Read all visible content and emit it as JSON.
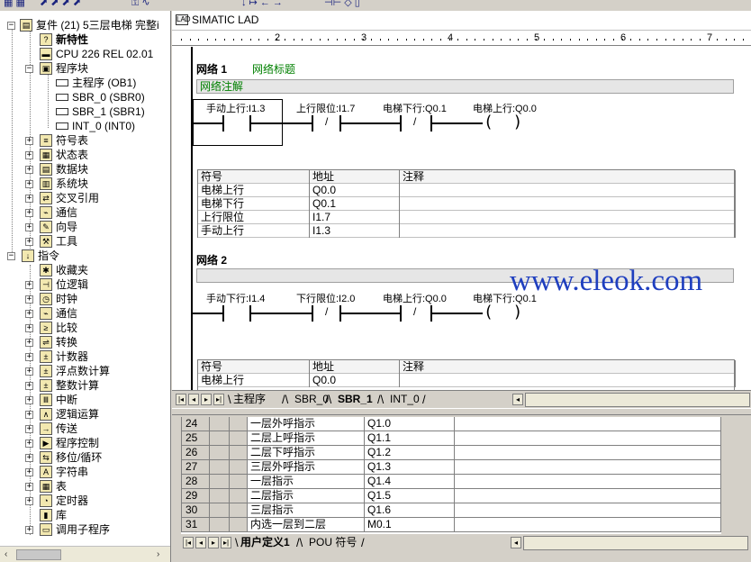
{
  "tree": {
    "project": "复件 (21) 5三层电梯 完整i",
    "items": [
      {
        "label": "新特性",
        "bold": true,
        "icon": "help-icon"
      },
      {
        "label": "CPU 226 REL 02.01",
        "icon": "cpu-icon"
      },
      {
        "label": "程序块",
        "icon": "program-block-icon"
      },
      {
        "label": "主程序 (OB1)",
        "icon": "program-icon"
      },
      {
        "label": "SBR_0 (SBR0)",
        "icon": "program-icon"
      },
      {
        "label": "SBR_1 (SBR1)",
        "icon": "program-icon"
      },
      {
        "label": "INT_0 (INT0)",
        "icon": "program-icon"
      },
      {
        "label": "符号表",
        "icon": "symbol-table-icon"
      },
      {
        "label": "状态表",
        "icon": "status-table-icon"
      },
      {
        "label": "数据块",
        "icon": "data-block-icon"
      },
      {
        "label": "系统块",
        "icon": "system-block-icon"
      },
      {
        "label": "交叉引用",
        "icon": "cross-reference-icon"
      },
      {
        "label": "通信",
        "icon": "communication-icon"
      },
      {
        "label": "向导",
        "icon": "wizard-icon"
      },
      {
        "label": "工具",
        "icon": "tools-icon"
      },
      {
        "label": "指令",
        "icon": "instructions-icon"
      },
      {
        "label": "收藏夹",
        "icon": "favorites-icon"
      },
      {
        "label": "位逻辑",
        "icon": "bit-logic-icon"
      },
      {
        "label": "时钟",
        "icon": "clock-icon"
      },
      {
        "label": "通信",
        "icon": "communication-icon"
      },
      {
        "label": "比较",
        "icon": "compare-icon"
      },
      {
        "label": "转换",
        "icon": "convert-icon"
      },
      {
        "label": "计数器",
        "icon": "counter-icon"
      },
      {
        "label": "浮点数计算",
        "icon": "float-math-icon"
      },
      {
        "label": "整数计算",
        "icon": "integer-math-icon"
      },
      {
        "label": "中断",
        "icon": "interrupt-icon"
      },
      {
        "label": "逻辑运算",
        "icon": "logic-ops-icon"
      },
      {
        "label": "传送",
        "icon": "move-icon"
      },
      {
        "label": "程序控制",
        "icon": "program-control-icon"
      },
      {
        "label": "移位/循环",
        "icon": "shift-rotate-icon"
      },
      {
        "label": "字符串",
        "icon": "string-icon"
      },
      {
        "label": "表",
        "icon": "table-icon"
      },
      {
        "label": "定时器",
        "icon": "timer-icon"
      },
      {
        "label": "库",
        "icon": "library-icon"
      },
      {
        "label": "调用子程序",
        "icon": "call-subroutine-icon"
      }
    ]
  },
  "editor": {
    "title": "SIMATIC LAD",
    "ruler": [
      "2",
      "3",
      "4",
      "5",
      "6",
      "7"
    ],
    "network1": {
      "title": "网络 1",
      "label": "网络标题",
      "comment": "网络注解",
      "contacts": [
        "手动上行:I1.3",
        "上行限位:I1.7",
        "电梯下行:Q0.1"
      ],
      "coil": "电梯上行:Q0.0",
      "table_headers": [
        "符号",
        "地址",
        "注释"
      ],
      "table_rows": [
        [
          "电梯上行",
          "Q0.0",
          ""
        ],
        [
          "电梯下行",
          "Q0.1",
          ""
        ],
        [
          "上行限位",
          "I1.7",
          ""
        ],
        [
          "手动上行",
          "I1.3",
          ""
        ]
      ]
    },
    "network2": {
      "title": "网络 2",
      "contacts": [
        "手动下行:I1.4",
        "下行限位:I2.0",
        "电梯上行:Q0.0"
      ],
      "coil": "电梯下行:Q0.1",
      "table_headers": [
        "符号",
        "地址",
        "注释"
      ],
      "table_rows": [
        [
          "电梯上行",
          "Q0.0",
          ""
        ]
      ]
    },
    "tabs": [
      "主程序",
      "SBR_0",
      "SBR_1",
      "INT_0"
    ],
    "active_tab": "SBR_1"
  },
  "watermark": "www.eleok.com",
  "symbols": {
    "rows": [
      {
        "num": "24",
        "symbol": "一层外呼指示",
        "address": "Q1.0"
      },
      {
        "num": "25",
        "symbol": "二层上呼指示",
        "address": "Q1.1"
      },
      {
        "num": "26",
        "symbol": "二层下呼指示",
        "address": "Q1.2"
      },
      {
        "num": "27",
        "symbol": "三层外呼指示",
        "address": "Q1.3"
      },
      {
        "num": "28",
        "symbol": "一层指示",
        "address": "Q1.4"
      },
      {
        "num": "29",
        "symbol": "二层指示",
        "address": "Q1.5"
      },
      {
        "num": "30",
        "symbol": "三层指示",
        "address": "Q1.6"
      },
      {
        "num": "31",
        "symbol": "内选一层到二层",
        "address": "M0.1"
      }
    ],
    "tabs": [
      "用户定义1",
      "POU 符号"
    ],
    "active_tab": "用户定义1"
  }
}
